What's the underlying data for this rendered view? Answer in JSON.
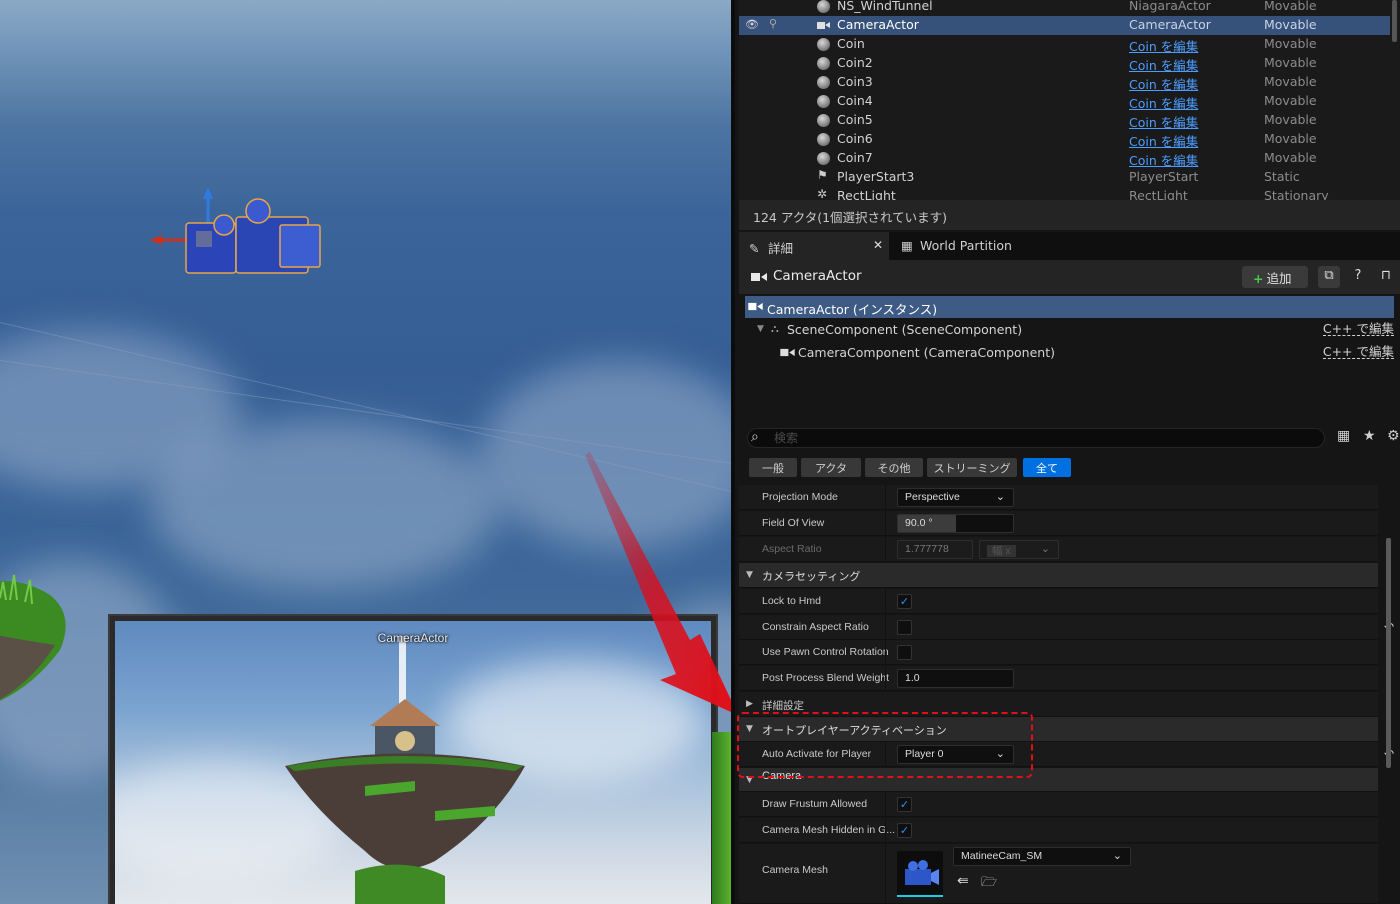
{
  "viewport": {
    "pip_label": "CameraActor"
  },
  "outliner": {
    "rows": [
      {
        "name": "NS_WindTunnel",
        "type": "NiagaraActor",
        "mobility": "Movable",
        "icon": "niagara-icon",
        "link": false
      },
      {
        "name": "CameraActor",
        "type": "CameraActor",
        "mobility": "Movable",
        "icon": "camera-icon",
        "link": false,
        "selected": true
      },
      {
        "name": "Coin",
        "type": "Coin を編集",
        "mobility": "Movable",
        "icon": "actor-icon",
        "link": true
      },
      {
        "name": "Coin2",
        "type": "Coin を編集",
        "mobility": "Movable",
        "icon": "actor-icon",
        "link": true
      },
      {
        "name": "Coin3",
        "type": "Coin を編集",
        "mobility": "Movable",
        "icon": "actor-icon",
        "link": true
      },
      {
        "name": "Coin4",
        "type": "Coin を編集",
        "mobility": "Movable",
        "icon": "actor-icon",
        "link": true
      },
      {
        "name": "Coin5",
        "type": "Coin を編集",
        "mobility": "Movable",
        "icon": "actor-icon",
        "link": true
      },
      {
        "name": "Coin6",
        "type": "Coin を編集",
        "mobility": "Movable",
        "icon": "actor-icon",
        "link": true
      },
      {
        "name": "Coin7",
        "type": "Coin を編集",
        "mobility": "Movable",
        "icon": "actor-icon",
        "link": true
      },
      {
        "name": "PlayerStart3",
        "type": "PlayerStart",
        "mobility": "Static",
        "icon": "flag-icon",
        "link": false
      },
      {
        "name": "RectLight",
        "type": "RectLight",
        "mobility": "Stationary",
        "icon": "light-icon",
        "link": false
      }
    ],
    "actor_count": "124 アクタ(1個選択されています)"
  },
  "tabs": {
    "details": "詳細",
    "world_partition": "World Partition"
  },
  "details": {
    "title": "CameraActor",
    "add_label": "追加",
    "components": [
      {
        "label": "CameraActor (インスタンス)",
        "edit": ""
      },
      {
        "label": "SceneComponent (SceneComponent)",
        "edit": "C++ で編集"
      },
      {
        "label": "CameraComponent (CameraComponent)",
        "edit": "C++ で編集"
      }
    ],
    "search_placeholder": "検索",
    "filters": [
      "一般",
      "アクタ",
      "その他",
      "ストリーミング",
      "全て"
    ],
    "active_filter": "全て"
  },
  "properties": {
    "projection_mode": {
      "label": "Projection Mode",
      "value": "Perspective"
    },
    "fov": {
      "label": "Field Of View",
      "value": "90.0 °",
      "fill_fraction": 0.5
    },
    "aspect_ratio": {
      "label": "Aspect Ratio",
      "value": "1.777778",
      "ratio_option": "幅 x"
    },
    "camera_settings": "カメラセッティング",
    "lock_to_hmd": {
      "label": "Lock to Hmd",
      "checked": true
    },
    "constrain_aspect": {
      "label": "Constrain Aspect Ratio",
      "checked": false
    },
    "use_pawn_rotation": {
      "label": "Use Pawn Control Rotation",
      "checked": false
    },
    "pp_blend_weight": {
      "label": "Post Process Blend Weight",
      "value": "1.0"
    },
    "advanced_settings": "詳細設定",
    "auto_player_activation": "オートプレイヤーアクティベーション",
    "auto_activate": {
      "label": "Auto Activate for Player",
      "value": "Player 0"
    },
    "camera_section": "Camera",
    "draw_frustum": {
      "label": "Draw Frustum Allowed",
      "checked": true
    },
    "mesh_hidden": {
      "label": "Camera Mesh Hidden in G...",
      "checked": true
    },
    "camera_mesh": {
      "label": "Camera Mesh",
      "value": "MatineeCam_SM"
    }
  },
  "colors": {
    "selection": "#36517a",
    "accent_blue": "#0070e0",
    "link_blue": "#4d9dff",
    "highlight_red": "#e0101a",
    "check_blue": "#2f8eff"
  }
}
